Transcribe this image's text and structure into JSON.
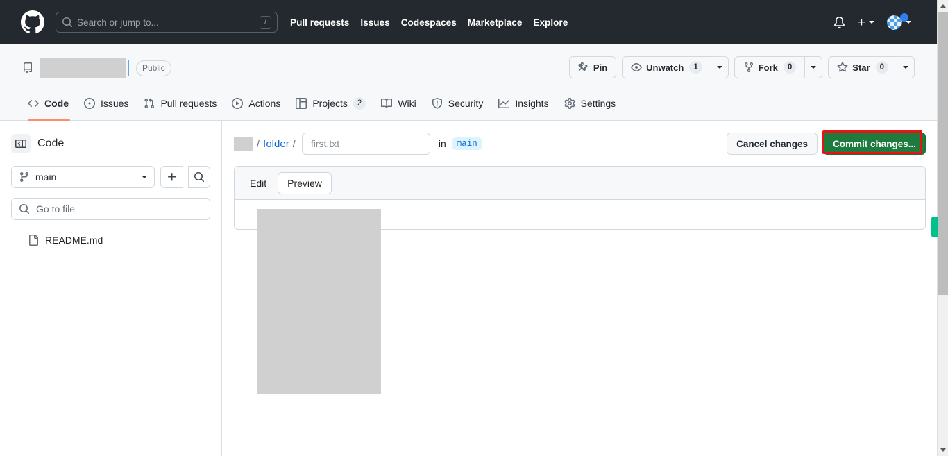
{
  "header": {
    "logo_icon": "github-mark-icon",
    "search": {
      "icon": "search-icon",
      "placeholder": "Search or jump to...",
      "value": "",
      "shortcut_badge": "/"
    },
    "nav": [
      {
        "label": "Pull requests"
      },
      {
        "label": "Issues"
      },
      {
        "label": "Codespaces"
      },
      {
        "label": "Marketplace"
      },
      {
        "label": "Explore"
      }
    ],
    "right": {
      "notifications_icon": "bell-icon",
      "create_new_glyph": "+",
      "create_new_caret_icon": "chevron-down-icon",
      "avatar_icon": "avatar",
      "avatar_status_icon": "status-dot-icon",
      "profile_caret_icon": "chevron-down-icon"
    }
  },
  "repo": {
    "repo_icon": "repo-icon",
    "name": "",
    "visibility": "Public",
    "actions": {
      "pin": {
        "label": "Pin",
        "icon": "pin-icon"
      },
      "watch": {
        "label": "Unwatch",
        "count": "1",
        "icon": "eye-icon",
        "caret_icon": "chevron-down-icon"
      },
      "fork": {
        "label": "Fork",
        "count": "0",
        "icon": "fork-icon",
        "caret_icon": "chevron-down-icon"
      },
      "star": {
        "label": "Star",
        "count": "0",
        "icon": "star-icon",
        "caret_icon": "chevron-down-icon"
      }
    },
    "tabs": [
      {
        "label": "Code",
        "icon": "code-icon",
        "count": "",
        "active": true
      },
      {
        "label": "Issues",
        "icon": "issue-opened-icon",
        "count": ""
      },
      {
        "label": "Pull requests",
        "icon": "git-pull-request-icon",
        "count": ""
      },
      {
        "label": "Actions",
        "icon": "play-icon",
        "count": ""
      },
      {
        "label": "Projects",
        "icon": "table-icon",
        "count": "2"
      },
      {
        "label": "Wiki",
        "icon": "book-icon",
        "count": ""
      },
      {
        "label": "Security",
        "icon": "shield-icon",
        "count": ""
      },
      {
        "label": "Insights",
        "icon": "graph-icon",
        "count": ""
      },
      {
        "label": "Settings",
        "icon": "gear-icon",
        "count": ""
      }
    ]
  },
  "sidebar": {
    "toggle_icon": "sidebar-collapse-icon",
    "title": "Code",
    "branch": {
      "icon": "git-branch-icon",
      "name": "main",
      "caret_icon": "chevron-down-icon"
    },
    "add_button_icon": "plus-icon",
    "search_button_icon": "search-icon",
    "file_filter": {
      "icon": "search-icon",
      "placeholder": "Go to file",
      "value": ""
    },
    "files": [
      {
        "name": "README.md",
        "icon": "file-icon"
      }
    ]
  },
  "main": {
    "breadcrumb": {
      "repo_name": "",
      "separator": "/",
      "folder": "folder",
      "filename_placeholder": "first.txt",
      "filename_value": "",
      "in_label": "in",
      "branch": "main"
    },
    "cancel_label": "Cancel changes",
    "commit_label": "Commit changes...",
    "highlight_color": "#e81313",
    "commit_color": "#1f7a3d",
    "editor_tabs": [
      {
        "label": "Edit",
        "active": false
      },
      {
        "label": "Preview",
        "active": true
      }
    ]
  },
  "scrollbar": {
    "up_arrow_icon": "triangle-up-icon",
    "down_arrow_icon": "triangle-down-icon",
    "marker_color": "#00c08b"
  }
}
